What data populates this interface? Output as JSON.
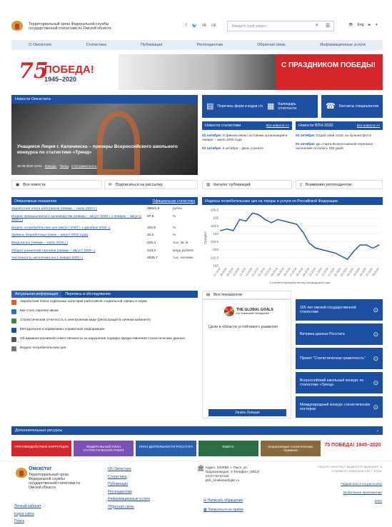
{
  "header": {
    "org_name": "Территориальный орган Федеральной службы государственной статистики по Омской области",
    "search_placeholder": "Введите свой запрос",
    "social": [
      "f",
      "🐦",
      "vk",
      "ok"
    ],
    "lang": "Eng"
  },
  "nav": [
    "О Омскстате",
    "Статистика",
    "Публикации",
    "Респондентам",
    "Обратная связь",
    "Информационные услуги"
  ],
  "banner": {
    "num": "75",
    "title": "ПОБЕДА!",
    "years": "1945–2020",
    "greeting": "С ПРАЗДНИКОМ ПОБЕДЫ!"
  },
  "news": {
    "header": "Новости Омскстата",
    "caption": "Учащиеся Лицея г. Калачинска – призеры Всероссийского школьного конкурса по статистике «Тренд»",
    "date": "30.09.2020 13:51",
    "tags": [
      "Конкурс",
      "Тренд",
      "Статграмотность"
    ]
  },
  "quick": [
    "Перечень форм и кодов статистики",
    "Календарь отчетности",
    "Контакты специалистов"
  ],
  "news_stat": {
    "header": "Новости статистики",
    "all": "Все новости >>",
    "items": [
      {
        "date": "02 октября:",
        "text": "О финансовом состоянии организаций в январе – июле 2020 года"
      },
      {
        "date": "02 октября:",
        "text": "5 октября – День учителя"
      }
    ]
  },
  "news_vpn": {
    "header": "Новости ВПН-2020",
    "all": "Все новости >>",
    "items": [
      {
        "date": "02 октября:",
        "text": "Отдай свой голос за лучшее фото!"
      },
      {
        "date": "01 октября:",
        "text": "До старта Всероссийской переписи населения осталось 180 дней"
      }
    ]
  },
  "row_links": [
    "Все новости",
    "Подписаться на рассылку",
    "Каталог публикаций",
    "Вниманию респондентов"
  ],
  "indicators": {
    "header": "Оперативные показатели",
    "link": "Официальная статистика",
    "rows": [
      {
        "name": "Заработная плата работников (январь – июль 2020 г.)",
        "value": "36521,6",
        "unit": "рубль"
      },
      {
        "name": "Индекс промышленного производства (январь – август 2020 г. к январю – августу 2019 г.)",
        "value": "97,6",
        "unit": "%"
      },
      {
        "name": "Индекс потребительских цен (август 2020 г. к декабрю 2019 г.)",
        "value": "102,6",
        "unit": "%"
      },
      {
        "name": "Уровень безработицы (июнь – август 2020 года)",
        "value": "10,2",
        "unit": "%"
      },
      {
        "name": "Ввод жилья (январь – июль 2020 г.)",
        "value": "225,4",
        "unit": "тыс. кв. м"
      },
      {
        "name": "Оборот розничной торговли (январь – август 2020 г.)",
        "value": "213,3",
        "unit": "млрд рублей"
      },
      {
        "name": "Численность населения (на 1 января 2020 г.)",
        "value": "1926,7",
        "unit": "тыс. человек"
      }
    ]
  },
  "chart_data": {
    "type": "line",
    "title": "Индексы потребительских цен на товары и услуги по Российской Федерации",
    "ylabel": "Процент",
    "xlabel": "к соответствующему месяцу предыдущего года",
    "ylim": [
      102,
      105.5
    ],
    "yticks": [
      "105.5",
      "105",
      "104.5",
      "104",
      "103.5",
      "103",
      "102.5",
      "102"
    ],
    "x": [
      "07.2018",
      "08.2018",
      "09.2018",
      "10.2018",
      "11.2018",
      "12.2018",
      "01.2019",
      "02.2019",
      "03.2019",
      "04.2019",
      "05.2019",
      "06.2019",
      "07.2019",
      "08.2019",
      "09.2019",
      "10.2019",
      "11.2019",
      "12.2019",
      "01.2020",
      "02.2020",
      "03.2020",
      "04.2020",
      "05.2020",
      "06.2020",
      "07.2020",
      "08.2020"
    ],
    "series": [
      {
        "values": [
          104.2,
          104.3,
          104.2,
          104.9,
          104.8,
          105.3,
          105.2,
          104.9,
          104.7,
          104.9,
          104.8,
          104.7,
          104.6,
          104.1,
          103.4,
          103.1,
          103.0,
          102.9,
          102.8,
          102.6,
          102.4,
          102.9,
          103.3,
          103.3,
          103.1,
          103.3
        ]
      }
    ]
  },
  "actual": {
    "tabs": [
      "Актуальная информация",
      "Перепись и обследования"
    ],
    "items": [
      "Заработная плата отдельных категорий работников социальной сферы и науки",
      "Как стать переписчиком",
      "Статистическая отчетность в электронном виде (регистрация в личном кабинете)",
      "Методология и нормативно-справочная информация",
      "Об административной ответственности за нарушение порядка предоставления статистических данных",
      "Индекс потребительских цен"
    ],
    "icon_colors": [
      "#e65c2c",
      "#2a6fc9",
      "#3e8a3c",
      "#1c4fa1",
      "#555",
      "#777"
    ]
  },
  "all_indicators": "Все показатели",
  "goals": {
    "logo": "THE GLOBAL GOALS",
    "sub": "For Sustainable Development",
    "text": "Цели в области устойчивого развития",
    "btn": "Узнать больше"
  },
  "tiles": [
    "165 лет омской государственной статистике",
    "Витрина данных Росстата",
    "Проект \"Статистическая грамотность\"",
    "Всероссийский школьный конкурс по статистике «Тренд»",
    "Международный конкурс статистических постеров"
  ],
  "resources": {
    "header": "Дополнительные ресурсы",
    "logos": [
      {
        "t": "ПРОТИВОДЕЙСТВИЕ КОРРУПЦИИ",
        "c": "#d4252b"
      },
      {
        "t": "ФЕДЕРАЛЬНЫЙ ПЛАН СТАТИСТИЧЕСКИХ РАБОТ",
        "c": "#7b4fb5"
      },
      {
        "t": "ПЛАН ДЕЯТЕЛЬНОСТИ РОССТАТА",
        "c": "#2a5fb0"
      },
      {
        "t": "ЕМИСС",
        "c": "#2d6e45"
      },
      {
        "t": "Энциклопедия статистических терминов",
        "c": "#8a6b3d"
      },
      {
        "t": "75 ПОБЕДА! 1945–2020",
        "c": "#ffffff"
      }
    ]
  },
  "footer": {
    "title": "Омскстат",
    "org": "Территориальный орган Федеральной службы государственной статистики по Омской области",
    "links_left": [
      "Личный кабинет",
      "Карта сайта",
      "Поиск"
    ],
    "links_mid": [
      "Об Омскстате",
      "Статистика",
      "Публикации",
      "Респондентам",
      "Информационные услуги",
      "Обратная связь"
    ],
    "contact": "Адрес: 644099, г. Омск, ул. Орджоникидзе, 3 Телефон: (3812) 23-07-53 Email: p55_omskstat@gks.ru",
    "actions": [
      "Написать обращение",
      "Записаться на приём"
    ],
    "right": [
      "Нашли опечатку? Выделите фрагмент и отправьте нажатием Ctrl + Enter",
      "Подписаться на рассылку",
      "Мобильное приложение",
      "RSS"
    ]
  }
}
